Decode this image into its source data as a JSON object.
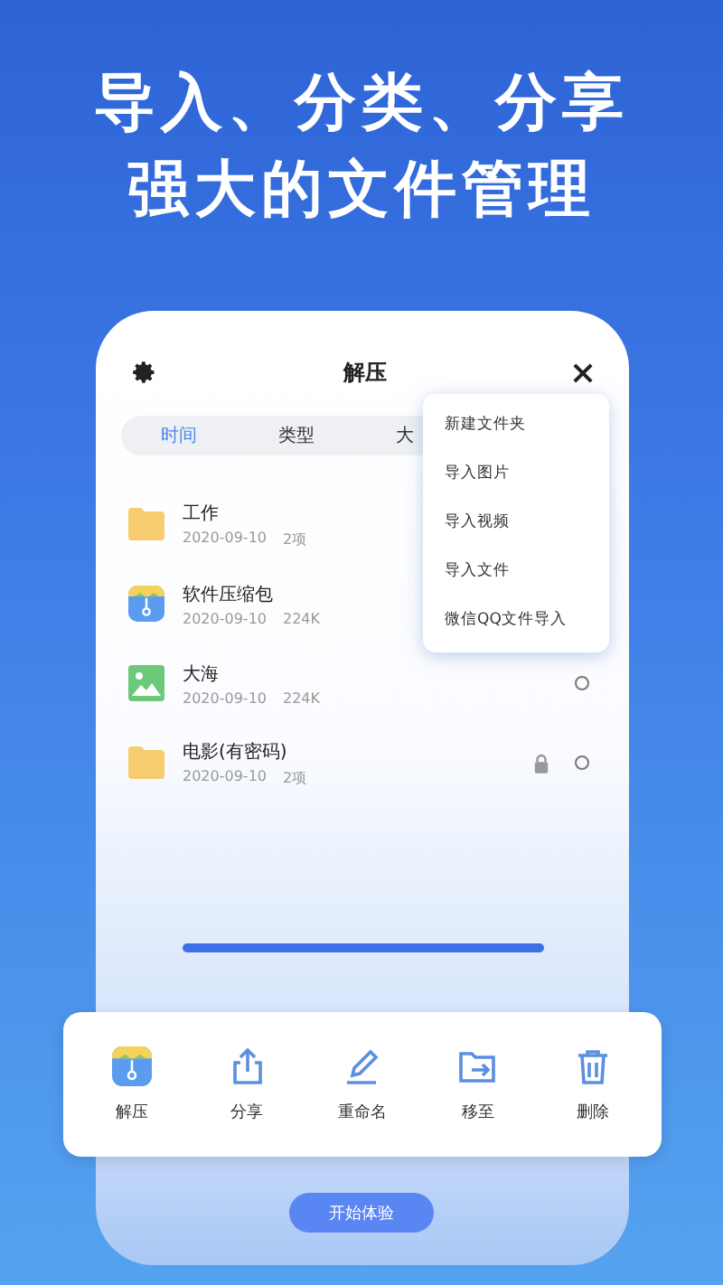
{
  "headline": [
    "导入、分类、分享",
    "强大的文件管理"
  ],
  "phone": {
    "title": "解压",
    "tabs": [
      {
        "label": "时间",
        "selected": true
      },
      {
        "label": "类型",
        "selected": false
      },
      {
        "label": "大",
        "selected": false
      }
    ],
    "menu": [
      "新建文件夹",
      "导入图片",
      "导入视频",
      "导入文件",
      "微信QQ文件导入"
    ],
    "files": [
      {
        "kind": "folder",
        "name": "工作",
        "date": "2020-09-10",
        "info": "2项",
        "locked": false
      },
      {
        "kind": "archive",
        "name": "软件压缩包",
        "date": "2020-09-10",
        "info": "224K",
        "locked": false
      },
      {
        "kind": "image",
        "name": "大海",
        "date": "2020-09-10",
        "info": "224K",
        "locked": false,
        "selected": false
      },
      {
        "kind": "folder",
        "name": "电影(有密码)",
        "date": "2020-09-10",
        "info": "2项",
        "locked": true,
        "selected": false
      }
    ],
    "start_button": "开始体验"
  },
  "actions": [
    {
      "kind": "extract",
      "label": "解压"
    },
    {
      "kind": "share",
      "label": "分享"
    },
    {
      "kind": "rename",
      "label": "重命名"
    },
    {
      "kind": "move",
      "label": "移至"
    },
    {
      "kind": "delete",
      "label": "删除"
    }
  ]
}
